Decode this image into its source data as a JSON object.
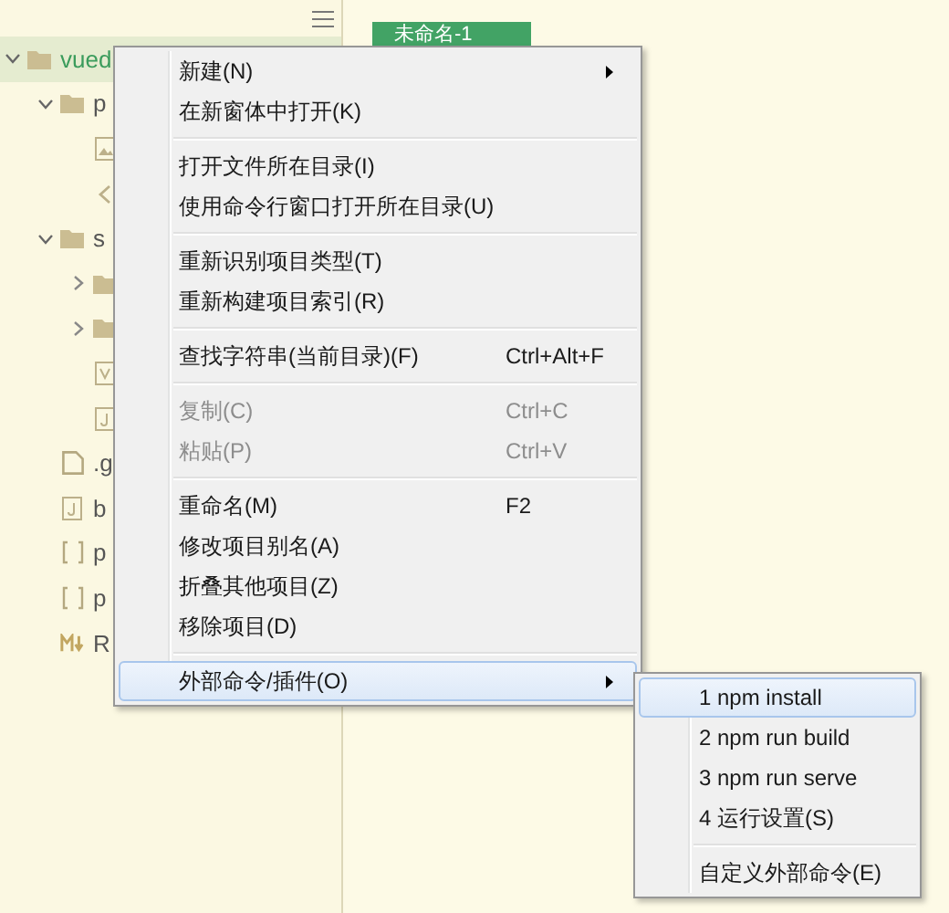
{
  "sidebar": {
    "items": [
      {
        "label": "vued",
        "kind": "folder",
        "expanded": true,
        "selected": true,
        "children": [
          {
            "label": "p",
            "kind": "folder",
            "expanded": true,
            "selected": false,
            "children": [
              {
                "kind": "image",
                "selected": false
              },
              {
                "kind": "code",
                "selected": false
              }
            ]
          },
          {
            "label": "s",
            "kind": "folder",
            "expanded": true,
            "selected": false,
            "children": [
              {
                "kind": "folder",
                "expanded": false,
                "selected": false
              },
              {
                "kind": "folder",
                "expanded": false,
                "selected": false
              },
              {
                "kind": "vue",
                "selected": false
              },
              {
                "kind": "script",
                "selected": false
              }
            ]
          },
          {
            "label": ".g",
            "kind": "file",
            "selected": false
          },
          {
            "label": "b",
            "kind": "script",
            "selected": false
          },
          {
            "label": "p",
            "kind": "json",
            "selected": false
          },
          {
            "label": "p",
            "kind": "json",
            "selected": false
          },
          {
            "label": "R",
            "kind": "markdown",
            "selected": false
          }
        ]
      }
    ]
  },
  "editor": {
    "tabs": [
      {
        "label": "未命名-1"
      }
    ]
  },
  "context_menu": {
    "items": [
      {
        "kind": "item",
        "label": "新建(N)",
        "submenu": true,
        "disabled": false,
        "selected": false
      },
      {
        "kind": "item",
        "label": "在新窗体中打开(K)",
        "disabled": false,
        "selected": false
      },
      {
        "kind": "separator"
      },
      {
        "kind": "item",
        "label": "打开文件所在目录(I)",
        "disabled": false,
        "selected": false
      },
      {
        "kind": "item",
        "label": "使用命令行窗口打开所在目录(U)",
        "disabled": false,
        "selected": false
      },
      {
        "kind": "separator"
      },
      {
        "kind": "item",
        "label": "重新识别项目类型(T)",
        "disabled": false,
        "selected": false
      },
      {
        "kind": "item",
        "label": "重新构建项目索引(R)",
        "disabled": false,
        "selected": false
      },
      {
        "kind": "separator"
      },
      {
        "kind": "item",
        "label": "查找字符串(当前目录)(F)",
        "shortcut": "Ctrl+Alt+F",
        "disabled": false,
        "selected": false
      },
      {
        "kind": "separator"
      },
      {
        "kind": "item",
        "label": "复制(C)",
        "shortcut": "Ctrl+C",
        "disabled": true,
        "selected": false
      },
      {
        "kind": "item",
        "label": "粘贴(P)",
        "shortcut": "Ctrl+V",
        "disabled": true,
        "selected": false
      },
      {
        "kind": "separator"
      },
      {
        "kind": "item",
        "label": "重命名(M)",
        "shortcut": "F2",
        "disabled": false,
        "selected": false
      },
      {
        "kind": "item",
        "label": "修改项目别名(A)",
        "disabled": false,
        "selected": false
      },
      {
        "kind": "item",
        "label": "折叠其他项目(Z)",
        "disabled": false,
        "selected": false
      },
      {
        "kind": "item",
        "label": "移除项目(D)",
        "disabled": false,
        "selected": false
      },
      {
        "kind": "separator"
      },
      {
        "kind": "item",
        "label": "外部命令/插件(O)",
        "submenu": true,
        "disabled": false,
        "selected": true
      }
    ]
  },
  "submenu": {
    "items": [
      {
        "kind": "item",
        "label": "1 npm install",
        "disabled": false,
        "selected": true
      },
      {
        "kind": "item",
        "label": "2 npm run build",
        "disabled": false,
        "selected": false
      },
      {
        "kind": "item",
        "label": "3 npm run serve",
        "disabled": false,
        "selected": false
      },
      {
        "kind": "item",
        "label": "4 运行设置(S)",
        "disabled": false,
        "selected": false
      },
      {
        "kind": "separator"
      },
      {
        "kind": "item",
        "label": "自定义外部命令(E)",
        "disabled": false,
        "selected": false
      }
    ]
  }
}
